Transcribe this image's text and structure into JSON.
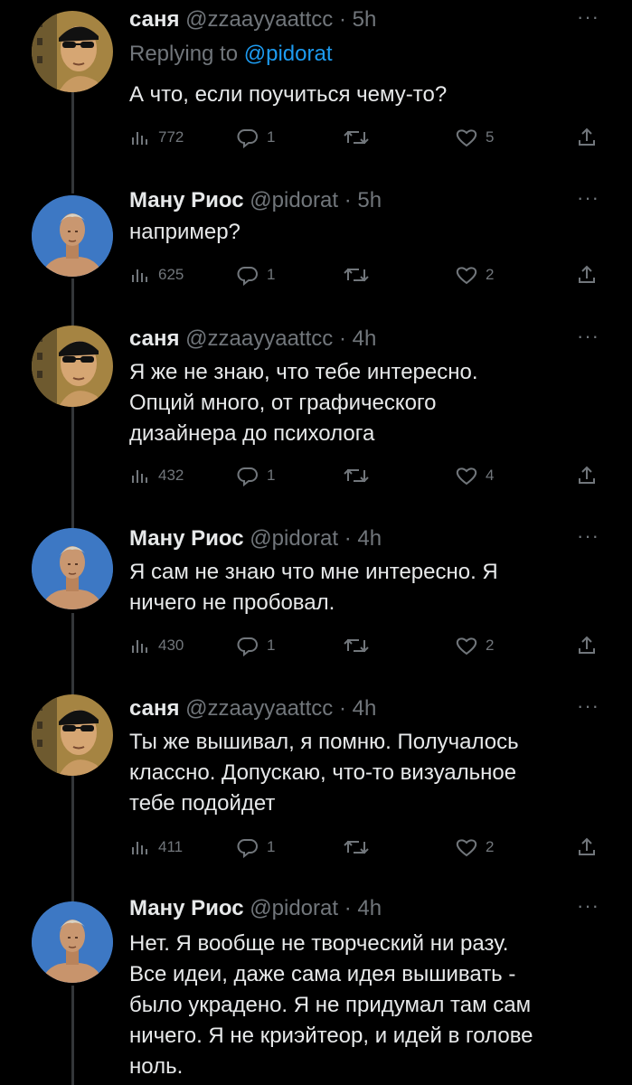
{
  "tweets": [
    {
      "author": "саня",
      "handle": "@zzaayyaattcc",
      "time": "5h",
      "replying_prefix": "Replying to",
      "replying_to": "@pidorat",
      "text": "А что, если поучиться чему-то?",
      "views": "772",
      "replies": "1",
      "retweets": "",
      "likes": "5"
    },
    {
      "author": "Ману Риос",
      "handle": "@pidorat",
      "time": "5h",
      "text": "например?",
      "views": "625",
      "replies": "1",
      "retweets": "",
      "likes": "2"
    },
    {
      "author": "саня",
      "handle": "@zzaayyaattcc",
      "time": "4h",
      "text": "Я же не знаю, что тебе интересно.\nОпций много, от графического\nдизайнера до психолога",
      "views": "432",
      "replies": "1",
      "retweets": "",
      "likes": "4"
    },
    {
      "author": "Ману Риос",
      "handle": "@pidorat",
      "time": "4h",
      "text": "Я сам не знаю что мне интересно. Я\nничего не пробовал.",
      "views": "430",
      "replies": "1",
      "retweets": "",
      "likes": "2"
    },
    {
      "author": "саня",
      "handle": "@zzaayyaattcc",
      "time": "4h",
      "text": "Ты же вышивал, я помню. Получалось\nклассно. Допускаю, что-то визуальное\nтебе подойдет",
      "views": "411",
      "replies": "1",
      "retweets": "",
      "likes": "2"
    },
    {
      "author": "Ману Риос",
      "handle": "@pidorat",
      "time": "4h",
      "text": "Нет. Я вообще не творческий ни разу.\nВсе идеи, даже сама идея вышивать -\nбыло украдено. Я не придумал там сам\nничего. Я не криэйтеор, и идей в голове\nноль."
    }
  ],
  "separator": "·",
  "colors": {
    "background": "#000000",
    "text": "#e7e9ea",
    "muted": "#71767b",
    "link": "#1d9bf0",
    "thread": "#333639"
  }
}
